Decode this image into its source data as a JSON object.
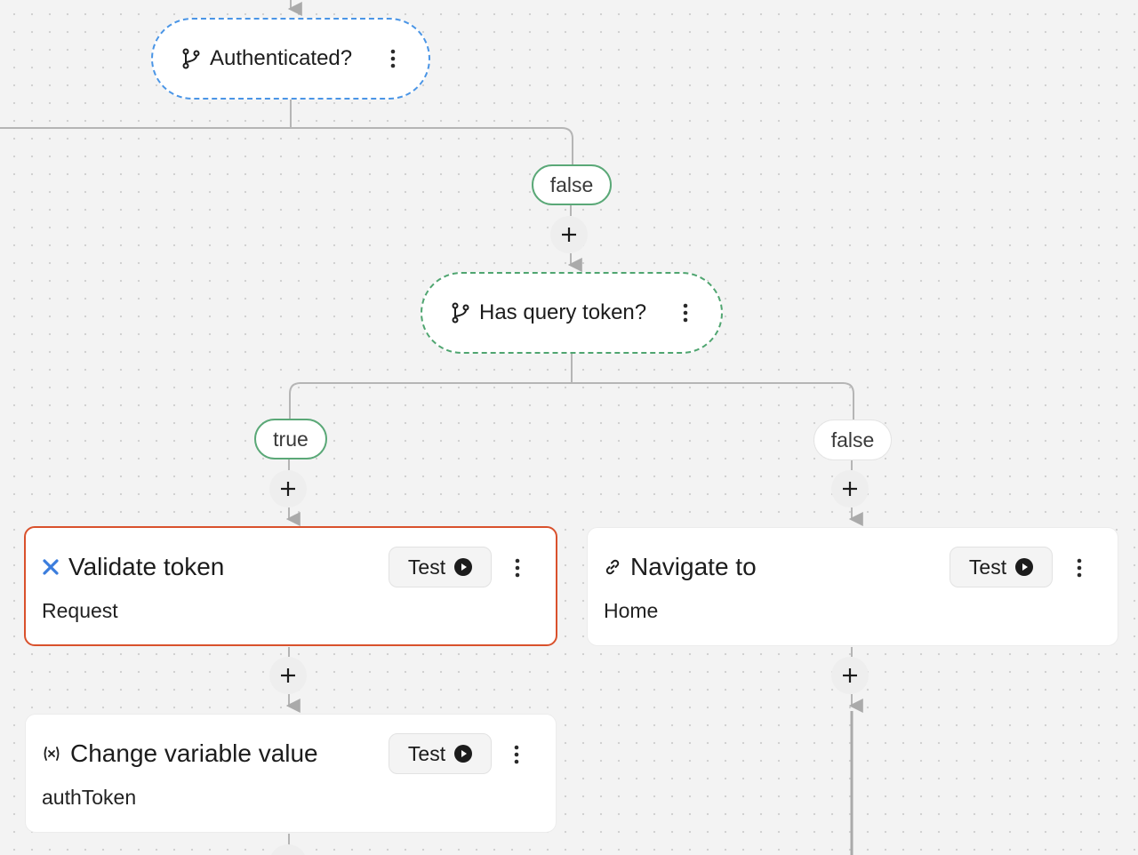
{
  "nodes": {
    "authenticated": {
      "label": "Authenticated?"
    },
    "has_query_token": {
      "label": "Has query token?"
    }
  },
  "branches": {
    "authenticated_false": "false",
    "query_true": "true",
    "query_false": "false"
  },
  "cards": {
    "validate_token": {
      "title": "Validate token",
      "subtitle": "Request",
      "test_label": "Test"
    },
    "navigate_to": {
      "title": "Navigate to",
      "subtitle": "Home",
      "test_label": "Test"
    },
    "change_variable": {
      "title": "Change variable value",
      "subtitle": "authToken",
      "test_label": "Test"
    }
  },
  "icons": {
    "condition": "branch-icon",
    "request": "request-icon",
    "navigate": "link-icon",
    "variable": "variable-icon",
    "add": "plus-icon",
    "play": "play-icon",
    "more": "more-vertical-icon"
  },
  "colors": {
    "selected_border": "#d9512c",
    "condition_blue": "#4a95e6",
    "condition_green": "#4fa570",
    "request_icon": "#3b7ddd",
    "edge": "#b5b5b5"
  }
}
